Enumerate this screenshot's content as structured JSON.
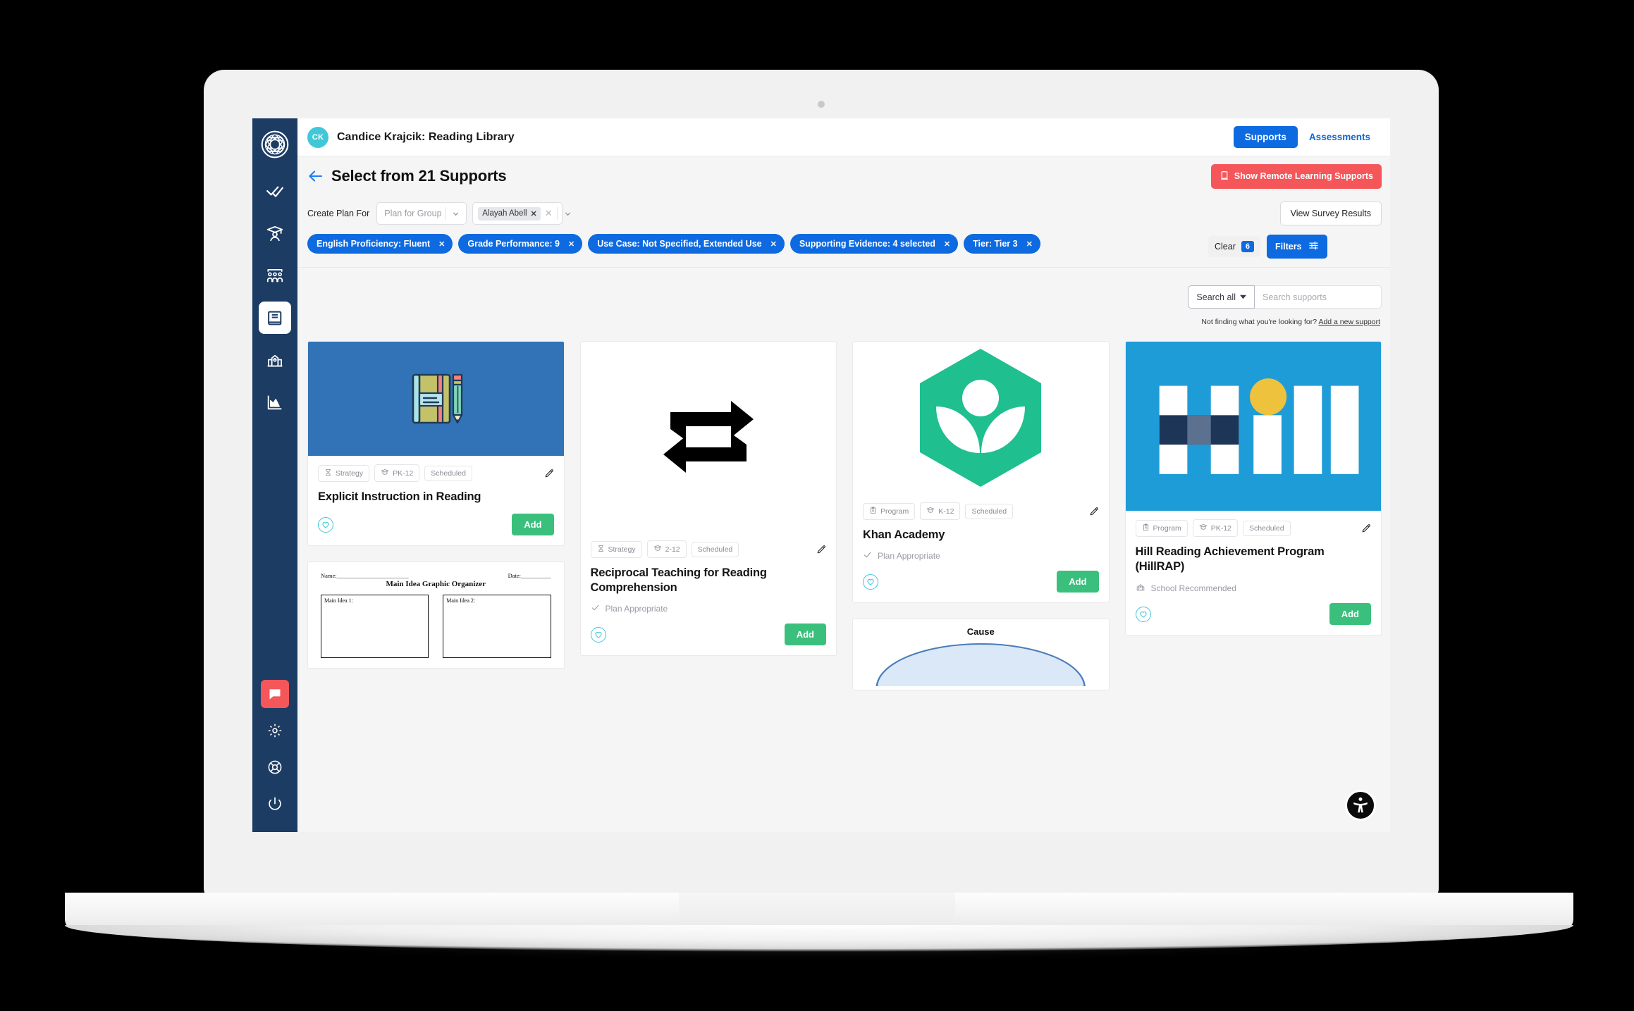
{
  "sidebar": {
    "logo": "globe-logo",
    "items": [
      {
        "name": "tasks",
        "icon": "double-check-icon",
        "active": false
      },
      {
        "name": "students",
        "icon": "graduate-icon",
        "active": false
      },
      {
        "name": "groups",
        "icon": "class-roster-icon",
        "active": false
      },
      {
        "name": "library",
        "icon": "book-icon",
        "active": true
      },
      {
        "name": "school",
        "icon": "school-icon",
        "active": false
      },
      {
        "name": "reports",
        "icon": "chart-icon",
        "active": false
      }
    ],
    "bottom_items": [
      {
        "name": "messages",
        "icon": "chat-icon",
        "highlight": true
      },
      {
        "name": "settings",
        "icon": "gear-icon",
        "highlight": false
      },
      {
        "name": "help",
        "icon": "lifebuoy-icon",
        "highlight": false
      },
      {
        "name": "logout",
        "icon": "power-icon",
        "highlight": false
      }
    ]
  },
  "topbar": {
    "avatar_initials": "CK",
    "title": "Candice Krajcik: Reading Library",
    "tabs": [
      {
        "label": "Supports",
        "active": true
      },
      {
        "label": "Assessments",
        "active": false
      }
    ]
  },
  "page_header": {
    "back_icon": "arrow-left-icon",
    "title": "Select from 21 Supports",
    "remote_button": {
      "label": "Show Remote Learning Supports",
      "icon": "laptop-icon"
    }
  },
  "plan_row": {
    "label": "Create Plan For",
    "group_select_placeholder": "Plan for Group",
    "student_token": "Alayah Abell",
    "survey_button": "View Survey Results"
  },
  "filters": {
    "chips": [
      "English Proficiency: Fluent",
      "Grade Performance: 9",
      "Use Case: Not Specified, Extended Use",
      "Supporting Evidence: 4 selected",
      "Tier: Tier 3"
    ],
    "clear_label": "Clear",
    "clear_count": "6",
    "filters_label": "Filters"
  },
  "search": {
    "scope_label": "Search all",
    "placeholder": "Search supports",
    "not_finding_text": "Not finding what you're looking for?",
    "not_finding_link": "Add a new support"
  },
  "cards": [
    {
      "title": "Explicit Instruction in Reading",
      "badges": [
        {
          "label": "Strategy",
          "icon": "strategy-icon"
        },
        {
          "label": "PK-12",
          "icon": "grad-cap-icon"
        },
        {
          "label": "Scheduled",
          "icon": ""
        }
      ],
      "note": "",
      "note_icon": "",
      "add_label": "Add",
      "thumb": "notebook-pencil"
    },
    {
      "title": "Reciprocal Teaching for Reading Comprehension",
      "badges": [
        {
          "label": "Strategy",
          "icon": "strategy-icon"
        },
        {
          "label": "2-12",
          "icon": "grad-cap-icon"
        },
        {
          "label": "Scheduled",
          "icon": ""
        }
      ],
      "note": "Plan Appropriate",
      "note_icon": "check-icon",
      "add_label": "Add",
      "thumb": "repeat-arrows"
    },
    {
      "title": "Khan Academy",
      "badges": [
        {
          "label": "Program",
          "icon": "clipboard-icon"
        },
        {
          "label": "K-12",
          "icon": "grad-cap-icon"
        },
        {
          "label": "Scheduled",
          "icon": ""
        }
      ],
      "note": "Plan Appropriate",
      "note_icon": "check-icon",
      "add_label": "Add",
      "thumb": "khan-logo"
    },
    {
      "title": "Hill Reading Achievement Program (HillRAP)",
      "badges": [
        {
          "label": "Program",
          "icon": "clipboard-icon"
        },
        {
          "label": "PK-12",
          "icon": "grad-cap-icon"
        },
        {
          "label": "Scheduled",
          "icon": ""
        }
      ],
      "note": "School Recommended",
      "note_icon": "school-icon",
      "add_label": "Add",
      "thumb": "hill-logo"
    }
  ],
  "partial_cards": {
    "graphic_organizer": {
      "name_label": "Name:",
      "date_label": "Date:",
      "title": "Main Idea Graphic Organizer",
      "box1": "Main Idea 1:",
      "box2": "Main Idea 2:"
    },
    "cause_effect": {
      "title": "Cause"
    }
  },
  "accessibility": {
    "fab_icon": "accessibility-icon"
  },
  "colors": {
    "sidebar": "#1d3c63",
    "primary_blue": "#0d6ae0",
    "danger_red": "#f4565a",
    "green_add": "#3ac07c",
    "teal_avatar": "#41c8d8"
  }
}
